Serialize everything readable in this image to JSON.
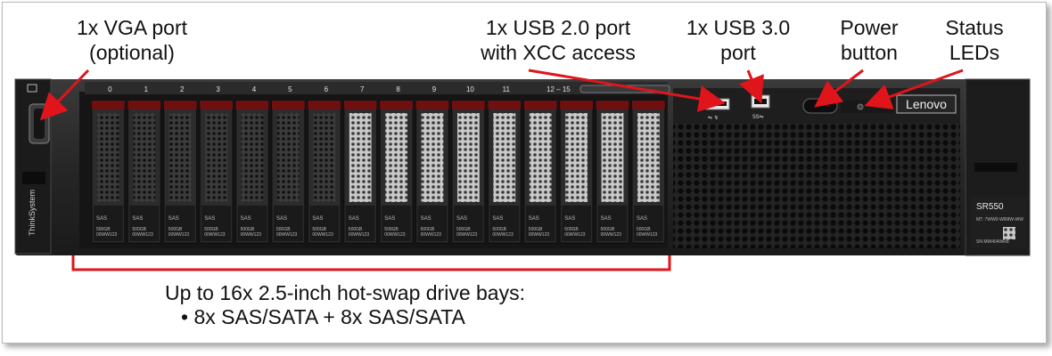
{
  "callouts": {
    "vga": [
      "1x VGA port",
      "(optional)"
    ],
    "usb2": [
      "1x USB 2.0 port",
      "with XCC access"
    ],
    "usb3": [
      "1x USB 3.0",
      "port"
    ],
    "power": [
      "Power",
      "button"
    ],
    "leds": [
      "Status",
      "LEDs"
    ]
  },
  "drive_bays": {
    "title": "Up to 16x 2.5-inch hot-swap drive bays:",
    "bullet": "•  8x SAS/SATA + 8x SAS/SATA",
    "bay_numbers": [
      "0",
      "1",
      "2",
      "3",
      "4",
      "5",
      "6",
      "7",
      "8",
      "9",
      "10",
      "11",
      "12 – 15"
    ],
    "drive_label_type": "SAS",
    "drive_label_capacity": "500GB",
    "drive_label_pn": "00WW123"
  },
  "server": {
    "brand": "Lenovo",
    "side_brand": "ThinkSystem",
    "model": "SR550",
    "mt_label": "MT: 7WW0-WR8W-WW",
    "sn_label": "SN MW404WR8",
    "usb2_mark": "⇋ ↯",
    "usb3_mark": "SS⇋"
  },
  "colors": {
    "arrow": "#e0141b",
    "chassis": "#2a2a2a",
    "bezel": "#1c1c1c",
    "drive_handle": "#6e1010"
  }
}
